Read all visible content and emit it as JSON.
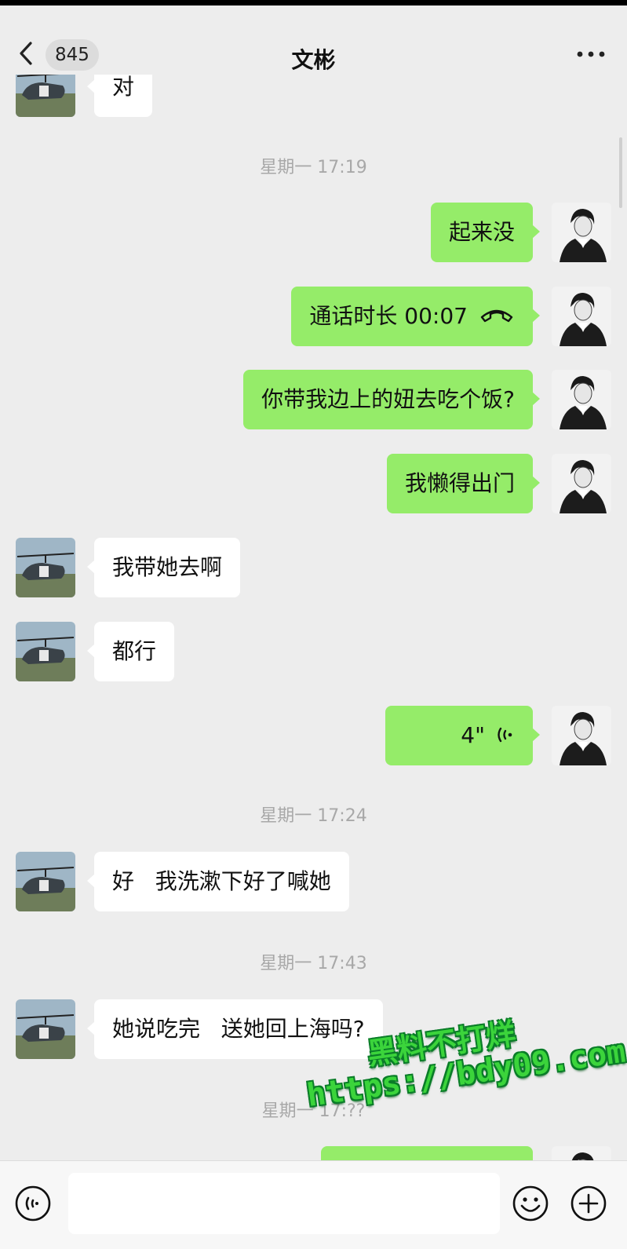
{
  "header": {
    "back_icon": "chevron-left-icon",
    "unread_count": "845",
    "contact_name": "文彬",
    "more_icon": "ellipsis-icon"
  },
  "messages": [
    {
      "side": "in",
      "text": "对",
      "partial": true
    },
    {
      "kind": "timestamp",
      "text": "星期一 17:19"
    },
    {
      "side": "out",
      "text": "起来没"
    },
    {
      "side": "out",
      "kind": "call",
      "text": "通话时长 00:07",
      "icon": "phone-hangup-icon"
    },
    {
      "side": "out",
      "text": "你带我边上的妞去吃个饭?"
    },
    {
      "side": "out",
      "text": "我懒得出门"
    },
    {
      "side": "in",
      "text": "我带她去啊"
    },
    {
      "side": "in",
      "text": "都行"
    },
    {
      "side": "out",
      "kind": "voice",
      "duration": "4\"",
      "icon": "voice-wave-icon"
    },
    {
      "kind": "timestamp",
      "text": "星期一 17:24"
    },
    {
      "side": "in",
      "text": "好   我洗漱下好了喊她"
    },
    {
      "kind": "timestamp",
      "text": "星期一 17:43"
    },
    {
      "side": "in",
      "text": "她说吃完   送她回上海吗?"
    },
    {
      "kind": "timestamp",
      "text": "星期一 17:??",
      "partial": true
    }
  ],
  "watermark": {
    "line1": "黑料不打烊",
    "line2": "https://bdy09.com"
  },
  "input_bar": {
    "voice_icon": "voice-input-icon",
    "input_value": "",
    "emoji_icon": "emoji-icon",
    "plus_icon": "plus-circle-icon"
  },
  "colors": {
    "background": "#ededed",
    "outgoing_bubble": "#95ec69",
    "incoming_bubble": "#ffffff",
    "timestamp_text": "#a8a8a8",
    "watermark": "#3bd43b"
  }
}
